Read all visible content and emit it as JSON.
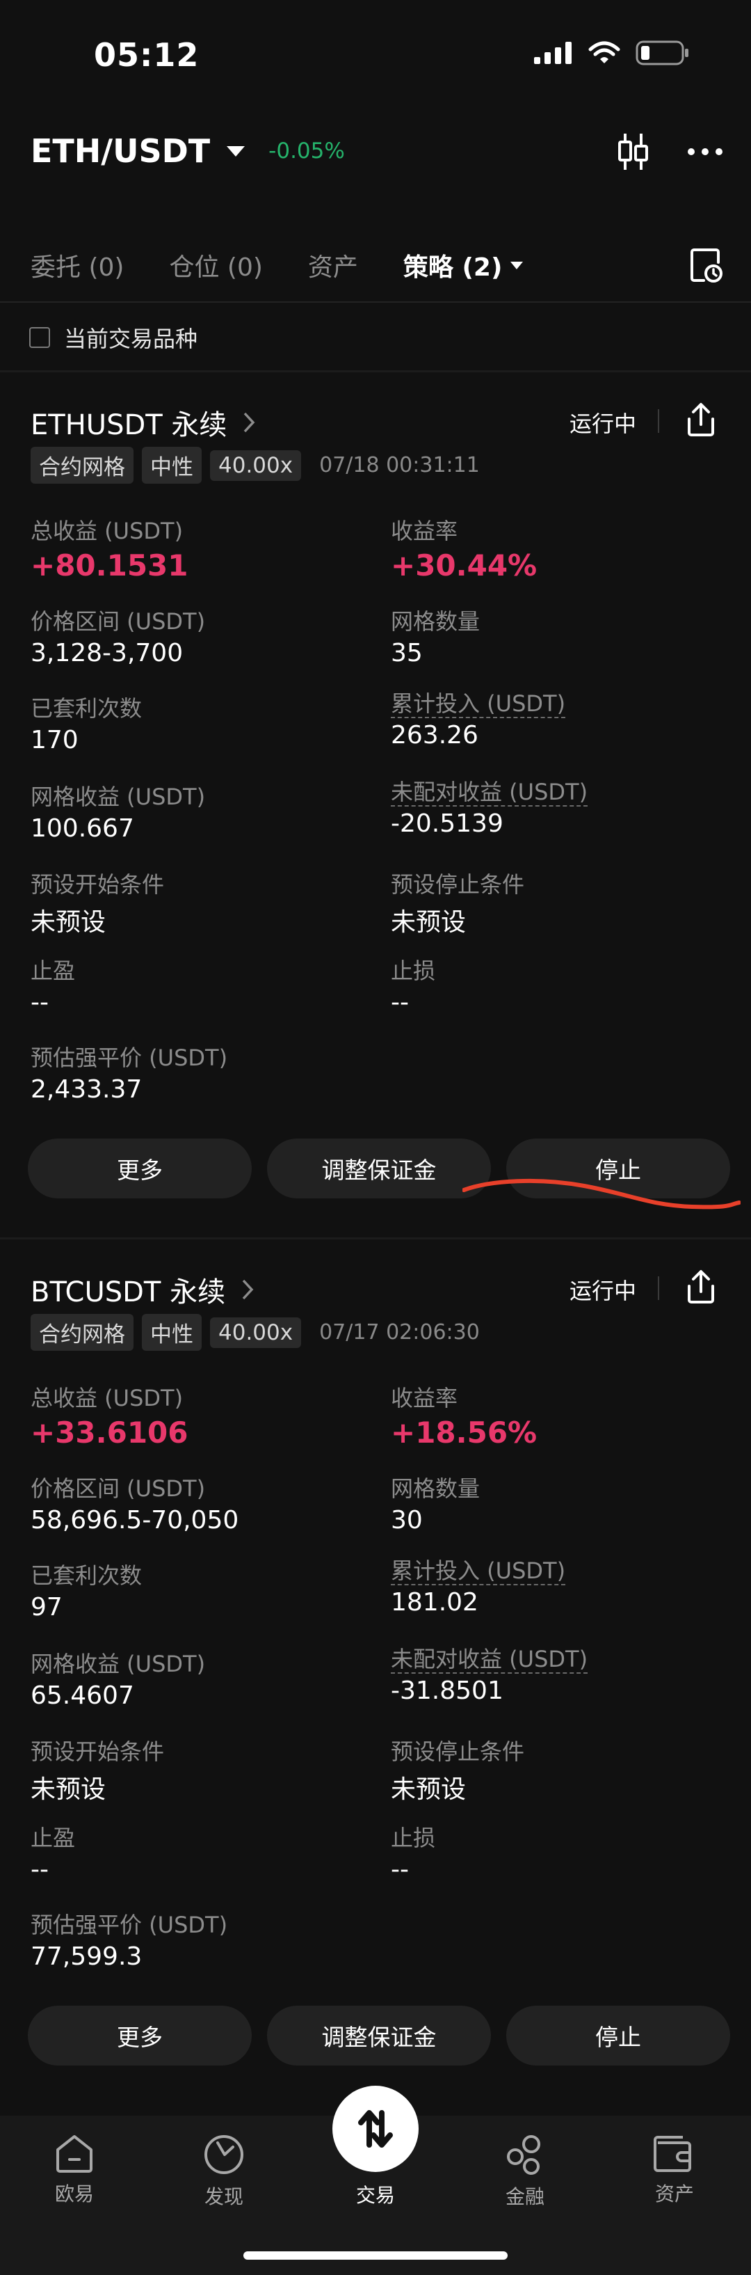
{
  "status_bar": {
    "time": "05:12"
  },
  "header": {
    "pair": "ETH/USDT",
    "change": "-0.05%"
  },
  "tabs": [
    {
      "label": "委托 (0)"
    },
    {
      "label": "仓位 (0)"
    },
    {
      "label": "资产"
    },
    {
      "label": "策略 (2)"
    }
  ],
  "filter": {
    "label": "当前交易品种",
    "checked": false
  },
  "cards": [
    {
      "title": "ETHUSDT 永续",
      "status": "运行中",
      "tags": [
        "合约网格",
        "中性",
        "40.00x"
      ],
      "timestamp": "07/18 00:31:11",
      "metrics": [
        {
          "label": "总收益 (USDT)",
          "value": "+80.1531"
        },
        {
          "label": "收益率",
          "value": "+30.44%"
        },
        {
          "label": "价格区间 (USDT)",
          "value": "3,128-3,700"
        },
        {
          "label": "网格数量",
          "value": "35"
        },
        {
          "label": "已套利次数",
          "value": "170"
        },
        {
          "label": "累计投入 (USDT)",
          "value": "263.26"
        },
        {
          "label": "网格收益 (USDT)",
          "value": "100.667"
        },
        {
          "label": "未配对收益 (USDT)",
          "value": "-20.5139"
        },
        {
          "label": "预设开始条件",
          "value": "未预设"
        },
        {
          "label": "预设停止条件",
          "value": "未预设"
        },
        {
          "label": "止盈",
          "value": "--"
        },
        {
          "label": "止损",
          "value": "--"
        },
        {
          "label": "预估强平价 (USDT)",
          "value": "2,433.37"
        }
      ],
      "buttons": [
        "更多",
        "调整保证金",
        "停止"
      ]
    },
    {
      "title": "BTCUSDT 永续",
      "status": "运行中",
      "tags": [
        "合约网格",
        "中性",
        "40.00x"
      ],
      "timestamp": "07/17 02:06:30",
      "metrics": [
        {
          "label": "总收益 (USDT)",
          "value": "+33.6106"
        },
        {
          "label": "收益率",
          "value": "+18.56%"
        },
        {
          "label": "价格区间 (USDT)",
          "value": "58,696.5-70,050"
        },
        {
          "label": "网格数量",
          "value": "30"
        },
        {
          "label": "已套利次数",
          "value": "97"
        },
        {
          "label": "累计投入 (USDT)",
          "value": "181.02"
        },
        {
          "label": "网格收益 (USDT)",
          "value": "65.4607"
        },
        {
          "label": "未配对收益 (USDT)",
          "value": "-31.8501"
        },
        {
          "label": "预设开始条件",
          "value": "未预设"
        },
        {
          "label": "预设停止条件",
          "value": "未预设"
        },
        {
          "label": "止盈",
          "value": "--"
        },
        {
          "label": "止损",
          "value": "--"
        },
        {
          "label": "预估强平价 (USDT)",
          "value": "77,599.3"
        }
      ],
      "buttons": [
        "更多",
        "调整保证金",
        "停止"
      ]
    }
  ],
  "bottom_nav": [
    {
      "label": "欧易",
      "icon": "home-icon"
    },
    {
      "label": "发现",
      "icon": "discover-icon"
    },
    {
      "label": "交易",
      "icon": "trade-swap-icon"
    },
    {
      "label": "金融",
      "icon": "finance-icon"
    },
    {
      "label": "资产",
      "icon": "wallet-icon"
    }
  ],
  "colors": {
    "positive": "#e8386b",
    "change_green": "#25b36b",
    "background": "#111111",
    "annotation_stroke": "#e8402a"
  }
}
